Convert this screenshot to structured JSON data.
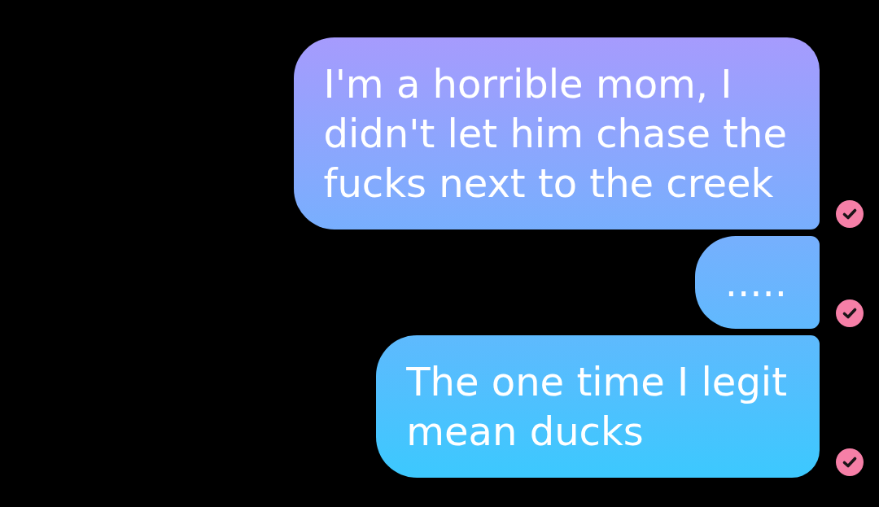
{
  "messages": [
    {
      "lines": [
        "I'm a horrible mom, I",
        "didn't let him chase the",
        "fucks next to the creek"
      ],
      "read": true
    },
    {
      "lines": [
        "....."
      ],
      "read": true
    },
    {
      "lines": [
        "The one time I legit",
        "mean ducks"
      ],
      "read": true
    }
  ]
}
